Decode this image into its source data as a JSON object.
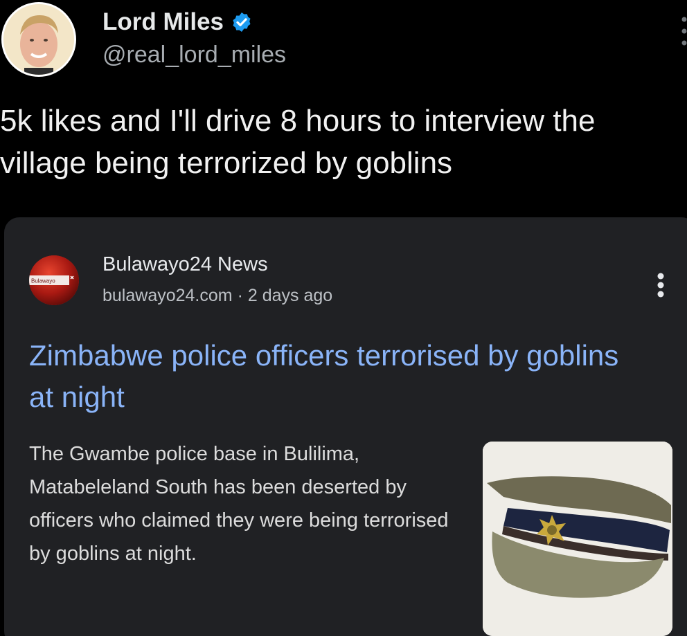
{
  "tweet": {
    "author_name": "Lord Miles",
    "author_handle": "@real_lord_miles",
    "text": "5k likes and I'll drive 8 hours to interview the village being terrorized by goblins",
    "verified_icon": "verified-badge-icon",
    "accent_color": "#1d9bf0"
  },
  "card": {
    "source_name": "Bulawayo24 News",
    "source_domain": "bulawayo24.com",
    "meta_separator": "·",
    "published": "2 days ago",
    "logo_text": "Bulawayo",
    "headline": "Zimbabwe police officers terrorised by goblins at night",
    "snippet": "The Gwambe police base in Bulilima, Matabeleland South has been deserted by officers who claimed they were being terrorised by goblins at night.",
    "headline_color": "#8ab4f8",
    "thumbnail": "police-cap-image"
  }
}
